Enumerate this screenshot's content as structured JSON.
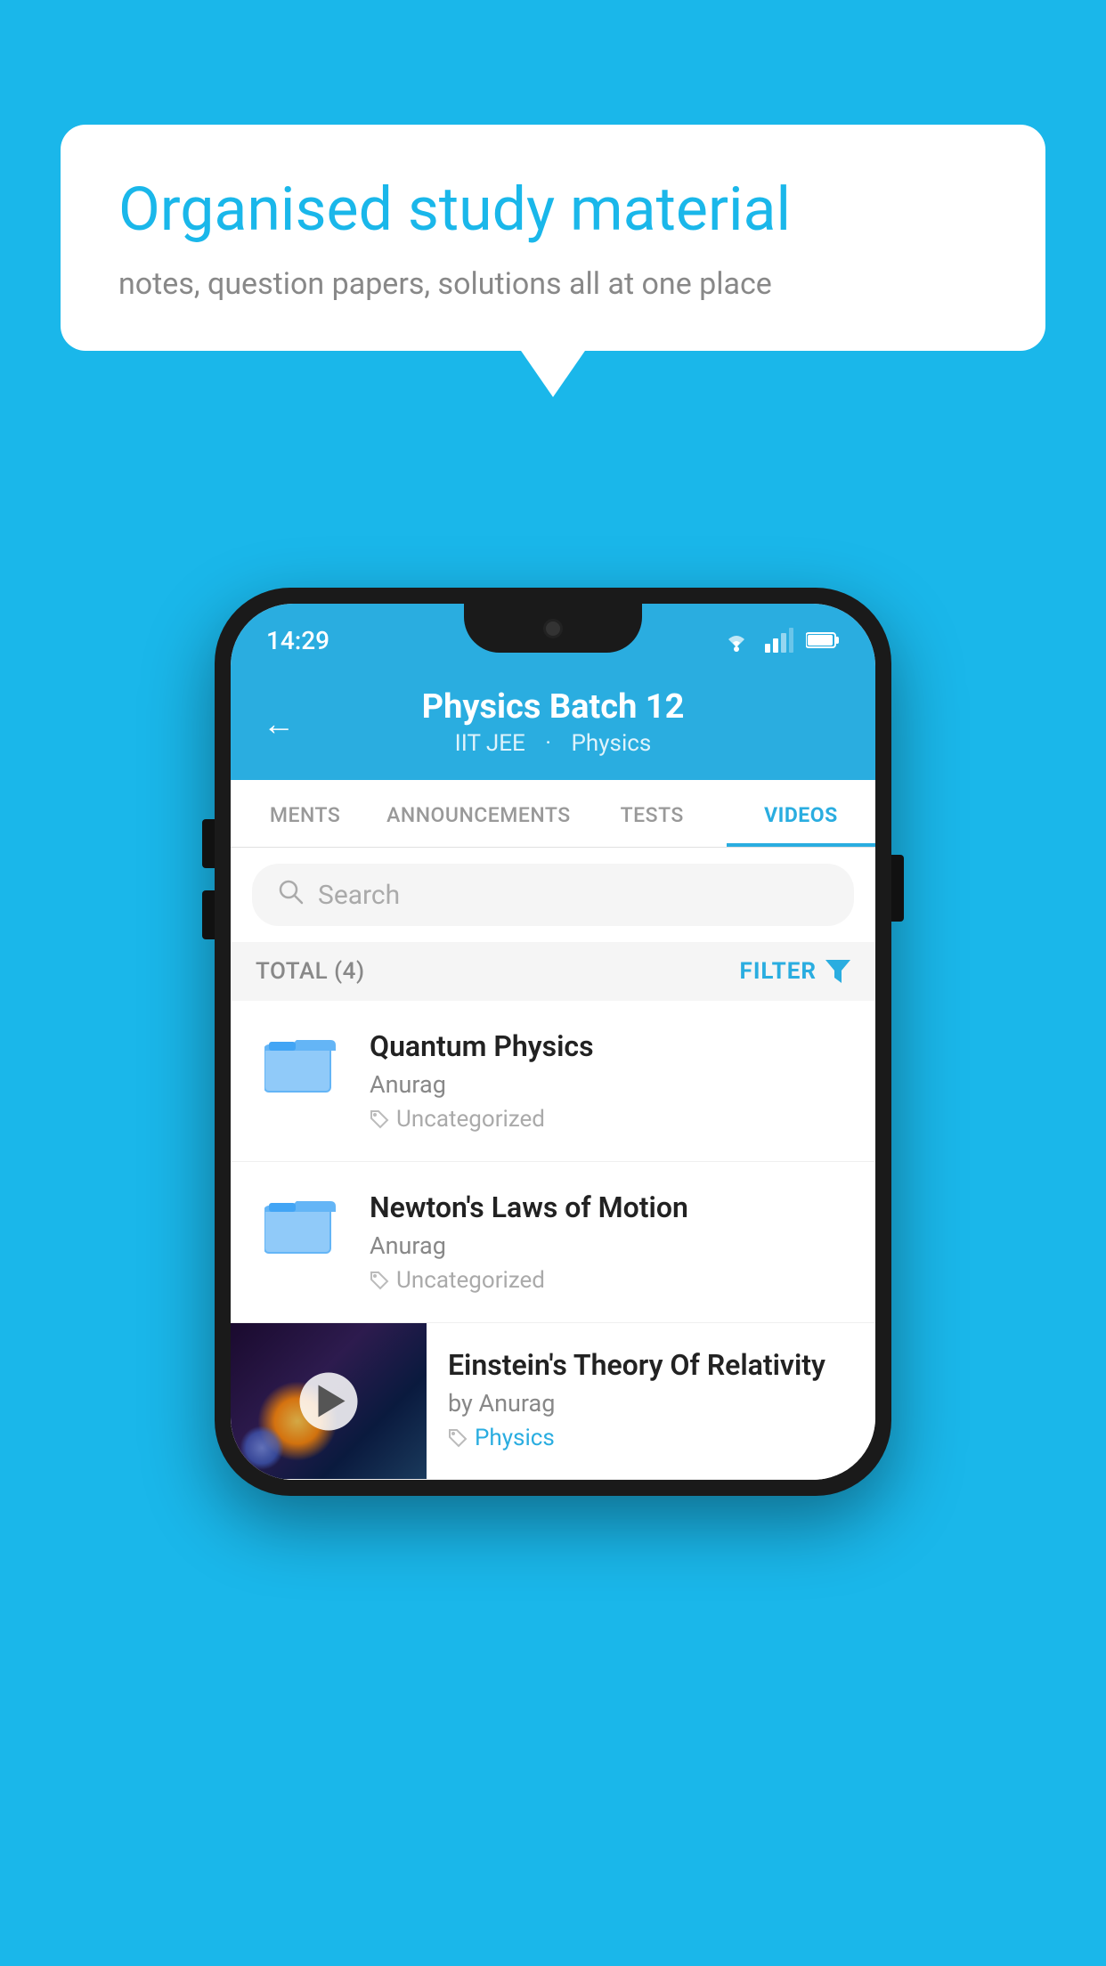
{
  "background_color": "#1ab7ea",
  "speech_bubble": {
    "title": "Organised study material",
    "subtitle": "notes, question papers, solutions all at one place"
  },
  "phone": {
    "status_bar": {
      "time": "14:29"
    },
    "header": {
      "back_label": "←",
      "title": "Physics Batch 12",
      "subtitle_part1": "IIT JEE",
      "subtitle_part2": "Physics"
    },
    "tabs": [
      {
        "label": "MENTS",
        "active": false
      },
      {
        "label": "ANNOUNCEMENTS",
        "active": false
      },
      {
        "label": "TESTS",
        "active": false
      },
      {
        "label": "VIDEOS",
        "active": true
      }
    ],
    "search": {
      "placeholder": "Search"
    },
    "filter_bar": {
      "total_label": "TOTAL (4)",
      "filter_label": "FILTER"
    },
    "videos": [
      {
        "title": "Quantum Physics",
        "author": "Anurag",
        "tag": "Uncategorized",
        "has_thumbnail": false
      },
      {
        "title": "Newton's Laws of Motion",
        "author": "Anurag",
        "tag": "Uncategorized",
        "has_thumbnail": false
      },
      {
        "title": "Einstein's Theory Of Relativity",
        "author": "by Anurag",
        "tag": "Physics",
        "has_thumbnail": true
      }
    ]
  }
}
